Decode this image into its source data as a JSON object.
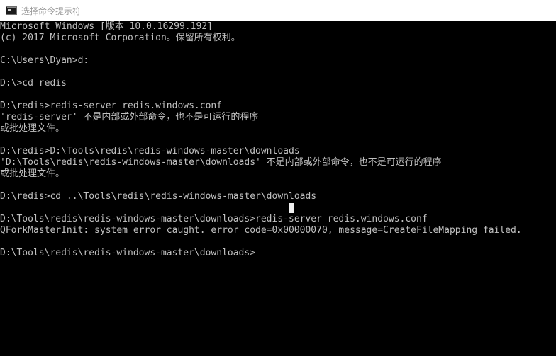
{
  "window": {
    "title": "选择命令提示符",
    "icon": "cmd-icon"
  },
  "console": {
    "lines": [
      "Microsoft Windows [版本 10.0.16299.192]",
      "(c) 2017 Microsoft Corporation。保留所有权利。",
      "C:\\Users\\Dyan>d:",
      "D:\\>cd redis",
      "D:\\redis>redis-server redis.windows.conf",
      "'redis-server' 不是内部或外部命令，也不是可运行的程序",
      "或批处理文件。",
      "D:\\redis>D:\\Tools\\redis\\redis-windows-master\\downloads",
      "'D:\\Tools\\redis\\redis-windows-master\\downloads' 不是内部或外部命令，也不是可运行的程序",
      "或批处理文件。",
      "D:\\redis>cd ..\\Tools\\redis\\redis-windows-master\\downloads",
      "D:\\Tools\\redis\\redis-windows-master\\downloads>redis-server redis.windows.conf",
      "QForkMasterInit: system error caught. error code=0x00000070, message=CreateFileMapping failed.",
      "D:\\Tools\\redis\\redis-windows-master\\downloads>"
    ]
  },
  "colors": {
    "background": "#000000",
    "text": "#c0c0c0",
    "titlebar": "#ffffff",
    "title_text": "#9a9a9a"
  }
}
